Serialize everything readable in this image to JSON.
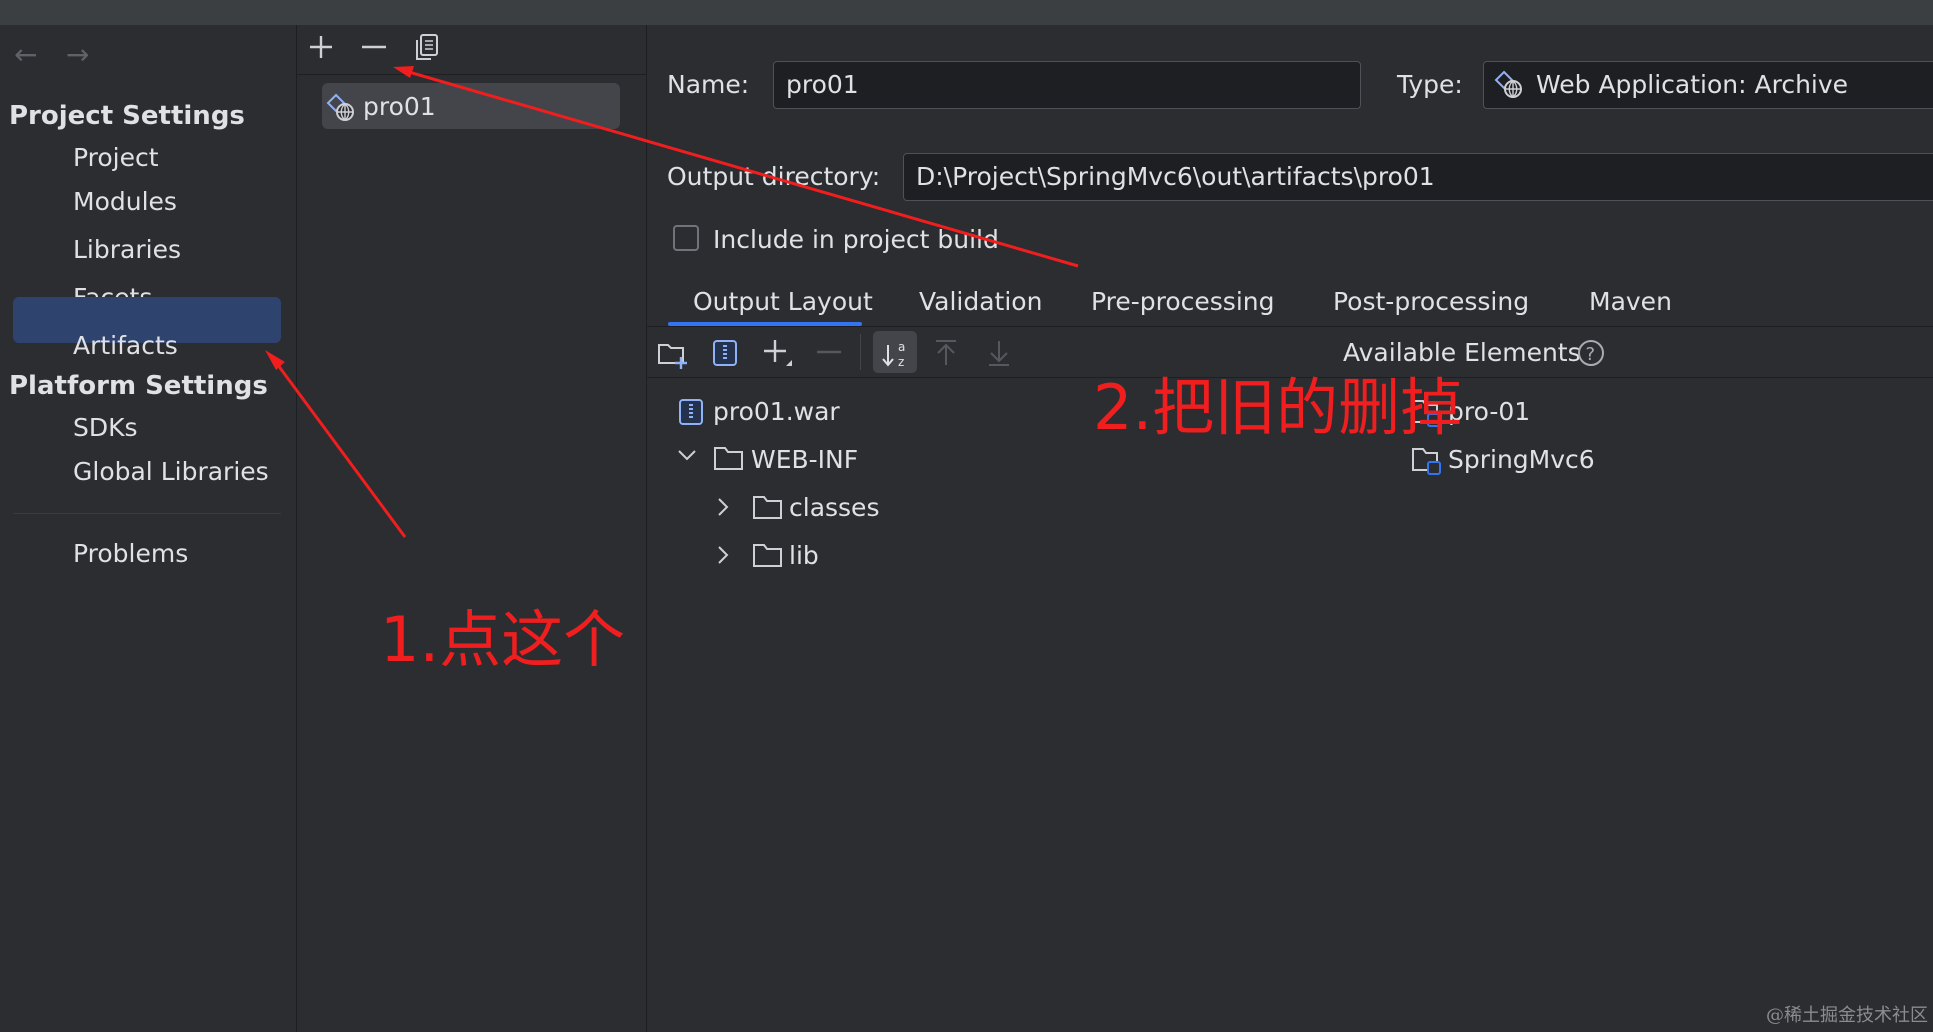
{
  "nav": {
    "back_icon": "arrow-left-icon",
    "forward_icon": "arrow-right-icon"
  },
  "sidebar": {
    "project_settings_header": "Project Settings",
    "project_items": [
      "Project",
      "Modules",
      "Libraries",
      "Facets",
      "Artifacts"
    ],
    "platform_settings_header": "Platform Settings",
    "platform_items": [
      "SDKs",
      "Global Libraries"
    ],
    "problems": "Problems",
    "selected": "Artifacts"
  },
  "list": {
    "toolbar_icons": [
      "plus-icon",
      "minus-icon",
      "copy-icon"
    ],
    "artifacts": [
      "pro01"
    ]
  },
  "artifact": {
    "name_label": "Name:",
    "name_value": "pro01",
    "type_label": "Type:",
    "type_value": "Web Application: Archive",
    "output_label": "Output directory:",
    "output_value": "D:\\Project\\SpringMvc6\\out\\artifacts\\pro01",
    "include_label": "Include in project build",
    "include_checked": false
  },
  "tabs": [
    "Output Layout",
    "Validation",
    "Pre-processing",
    "Post-processing",
    "Maven"
  ],
  "active_tab": "Output Layout",
  "layout_toolbar_icons": [
    "new-folder-icon",
    "archive-icon",
    "add-icon",
    "remove-icon",
    "sort-icon",
    "move-up-icon",
    "move-down-icon"
  ],
  "available_elements_label": "Available Elements",
  "output_tree": {
    "root": "pro01.war",
    "web_inf": "WEB-INF",
    "children": [
      "classes",
      "lib"
    ]
  },
  "available_elements": [
    "pro-01",
    "SpringMvc6"
  ],
  "annotations": {
    "step1": "1.点这个",
    "step2": "2.把旧的删掉",
    "color": "#f01e1e"
  },
  "watermark": "@稀土掘金技术社区",
  "colors": {
    "background": "#2b2d30",
    "selection": "#2e436e",
    "accent": "#3574f0"
  }
}
